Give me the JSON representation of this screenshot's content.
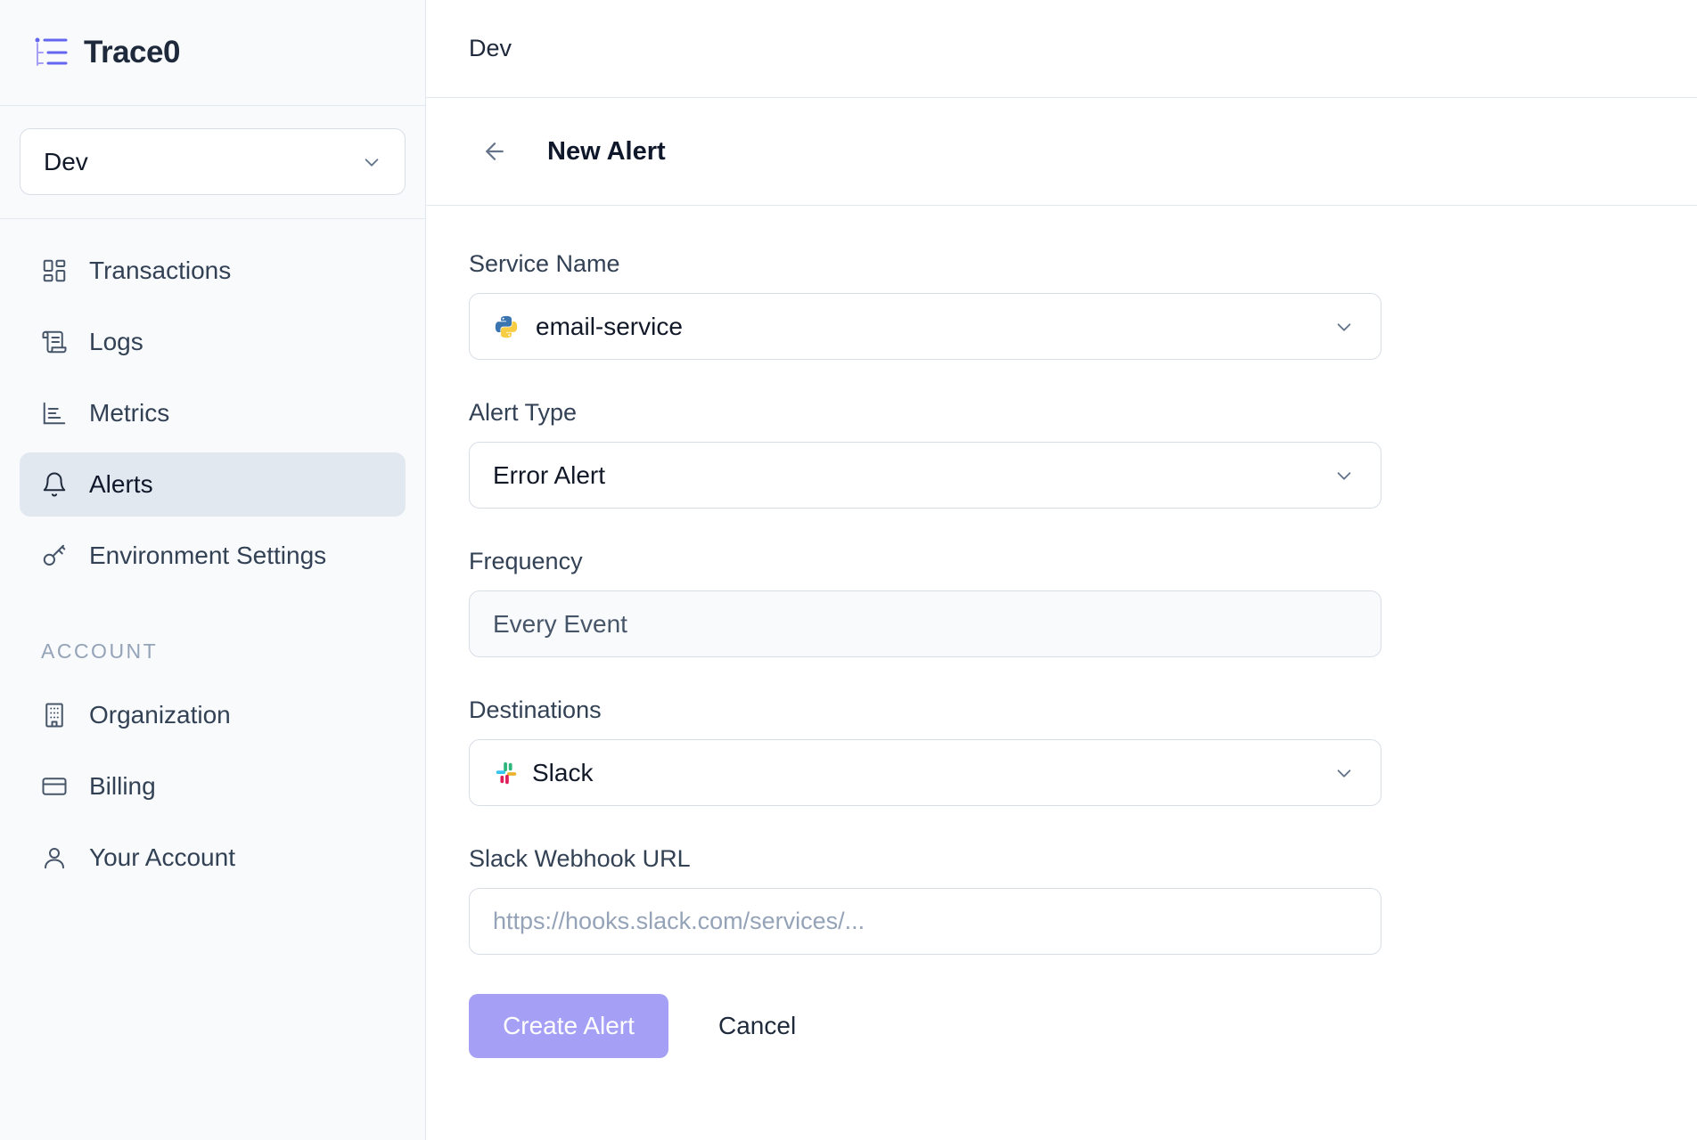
{
  "brand": {
    "name": "Trace0",
    "icon": "list-tree-icon",
    "accent": "#6366f1"
  },
  "env_select": {
    "value": "Dev"
  },
  "nav": {
    "items": [
      {
        "label": "Transactions",
        "icon": "layout-grid-icon"
      },
      {
        "label": "Logs",
        "icon": "scroll-icon"
      },
      {
        "label": "Metrics",
        "icon": "bar-chart-icon"
      },
      {
        "label": "Alerts",
        "icon": "bell-icon",
        "active": true
      },
      {
        "label": "Environment Settings",
        "icon": "key-icon"
      }
    ],
    "account_title": "ACCOUNT",
    "account_items": [
      {
        "label": "Organization",
        "icon": "building-icon"
      },
      {
        "label": "Billing",
        "icon": "credit-card-icon"
      },
      {
        "label": "Your Account",
        "icon": "user-icon"
      }
    ]
  },
  "topbar": {
    "title": "Dev"
  },
  "page": {
    "title": "New Alert"
  },
  "form": {
    "service_name": {
      "label": "Service Name",
      "value": "email-service",
      "icon": "python-icon"
    },
    "alert_type": {
      "label": "Alert Type",
      "value": "Error Alert"
    },
    "frequency": {
      "label": "Frequency",
      "value": "Every Event"
    },
    "destinations": {
      "label": "Destinations",
      "value": "Slack",
      "icon": "slack-icon"
    },
    "webhook": {
      "label": "Slack Webhook URL",
      "placeholder": "https://hooks.slack.com/services/..."
    },
    "submit_label": "Create Alert",
    "cancel_label": "Cancel",
    "submit_color": "#a5a0f5"
  }
}
